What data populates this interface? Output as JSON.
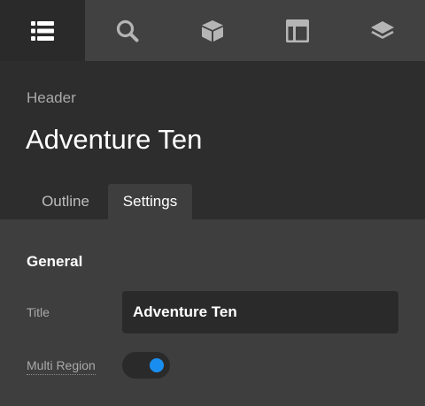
{
  "toolbar": {
    "tabs": [
      {
        "icon": "list-icon",
        "active": true
      },
      {
        "icon": "search-icon",
        "active": false
      },
      {
        "icon": "box-icon",
        "active": false
      },
      {
        "icon": "layout-icon",
        "active": false
      },
      {
        "icon": "layers-icon",
        "active": false
      }
    ]
  },
  "header": {
    "label": "Header",
    "title": "Adventure Ten",
    "tabs": [
      {
        "label": "Outline",
        "active": false
      },
      {
        "label": "Settings",
        "active": true
      }
    ]
  },
  "settings": {
    "section_title": "General",
    "title_field": {
      "label": "Title",
      "value": "Adventure Ten"
    },
    "multi_region": {
      "label": "Multi Region",
      "enabled": true
    }
  },
  "colors": {
    "accent": "#1a8ef0",
    "toolbar_bg": "#414141",
    "header_bg": "#2d2d2d",
    "panel_bg": "#3e3e3e"
  }
}
